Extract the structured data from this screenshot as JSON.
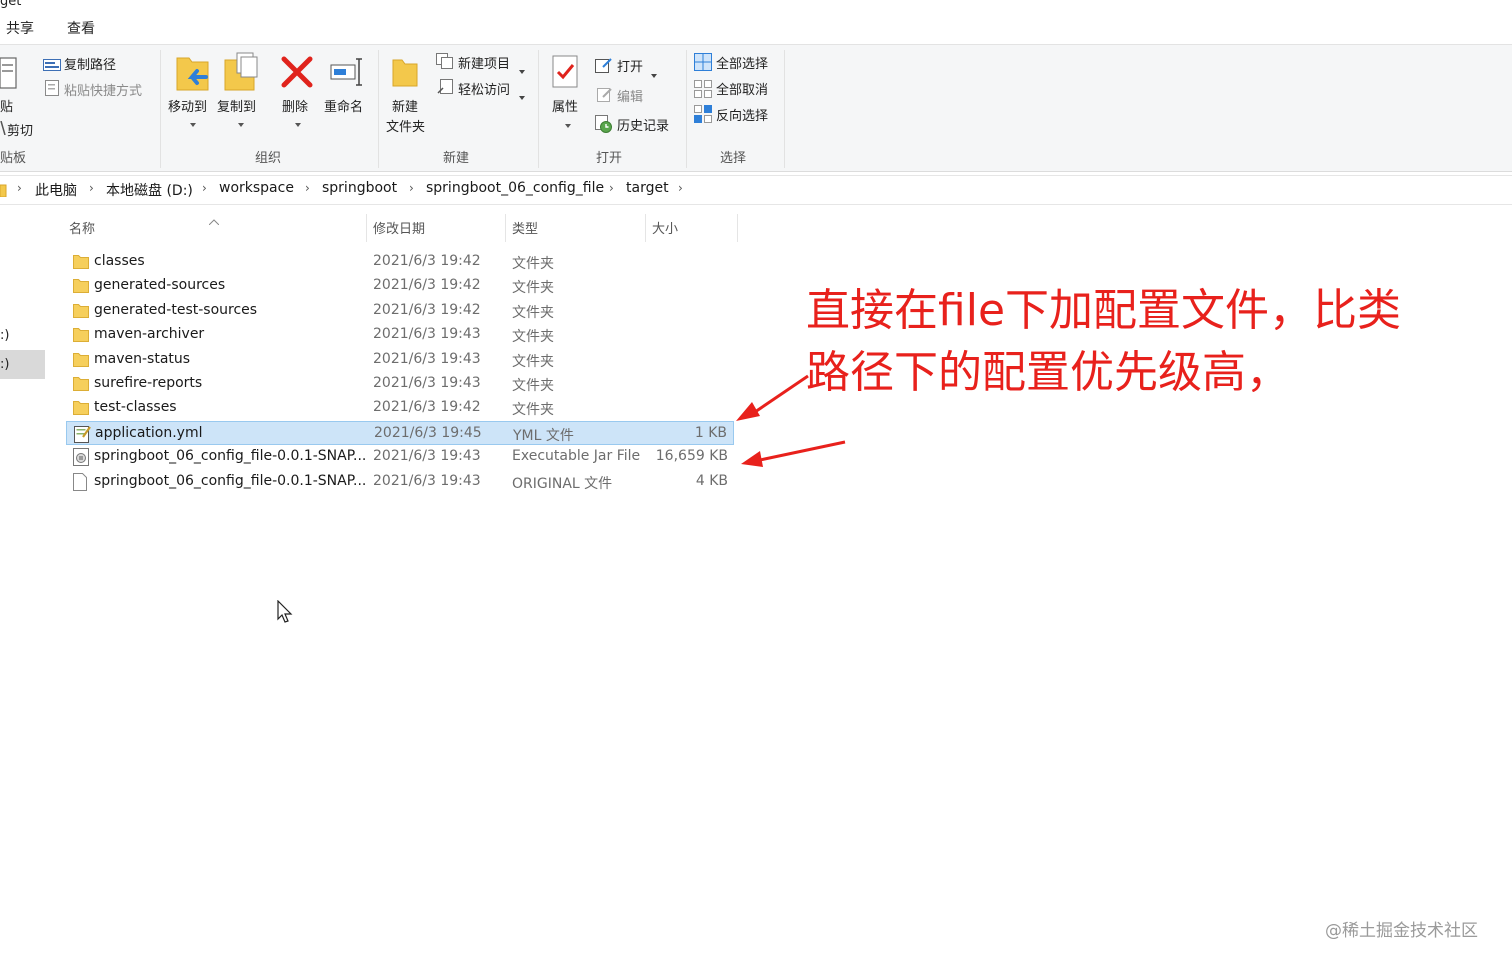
{
  "window": {
    "title_fragment": "get"
  },
  "menu_tabs": [
    {
      "label": "共享"
    },
    {
      "label": "查看"
    }
  ],
  "ribbon": {
    "clipboard": {
      "paste_fragment": "贴",
      "copy_path": "复制路径",
      "paste_shortcut": "粘贴快捷方式",
      "cut": "剪切",
      "group_fragment": "贴板"
    },
    "organize": {
      "move_to": "移动到",
      "copy_to": "复制到",
      "delete": "删除",
      "rename": "重命名",
      "group": "组织"
    },
    "new": {
      "new_folder_line1": "新建",
      "new_folder_line2": "文件夹",
      "new_item": "新建项目",
      "easy_access": "轻松访问",
      "group": "新建"
    },
    "open": {
      "properties": "属性",
      "open": "打开",
      "edit": "编辑",
      "history": "历史记录",
      "group": "打开"
    },
    "select": {
      "select_all": "全部选择",
      "select_none": "全部取消",
      "invert": "反向选择",
      "group": "选择"
    }
  },
  "address": {
    "breadcrumbs": [
      "此电脑",
      "本地磁盘 (D:)",
      "workspace",
      "springboot",
      "springboot_06_config_file",
      "target"
    ]
  },
  "nav": {
    "frag1": ":)",
    "frag2": ":)"
  },
  "columns": {
    "name": "名称",
    "modified": "修改日期",
    "type": "类型",
    "size": "大小"
  },
  "files": [
    {
      "name": "classes",
      "modified": "2021/6/3 19:42",
      "type": "文件夹",
      "size": "",
      "icon": "folder-icon"
    },
    {
      "name": "generated-sources",
      "modified": "2021/6/3 19:42",
      "type": "文件夹",
      "size": "",
      "icon": "folder-icon"
    },
    {
      "name": "generated-test-sources",
      "modified": "2021/6/3 19:42",
      "type": "文件夹",
      "size": "",
      "icon": "folder-icon"
    },
    {
      "name": "maven-archiver",
      "modified": "2021/6/3 19:43",
      "type": "文件夹",
      "size": "",
      "icon": "folder-icon"
    },
    {
      "name": "maven-status",
      "modified": "2021/6/3 19:43",
      "type": "文件夹",
      "size": "",
      "icon": "folder-icon"
    },
    {
      "name": "surefire-reports",
      "modified": "2021/6/3 19:43",
      "type": "文件夹",
      "size": "",
      "icon": "folder-icon"
    },
    {
      "name": "test-classes",
      "modified": "2021/6/3 19:42",
      "type": "文件夹",
      "size": "",
      "icon": "folder-icon"
    },
    {
      "name": "application.yml",
      "modified": "2021/6/3 19:45",
      "type": "YML 文件",
      "size": "1 KB",
      "icon": "yml-file-icon",
      "selected": true
    },
    {
      "name": "springboot_06_config_file-0.0.1-SNAP...",
      "modified": "2021/6/3 19:43",
      "type": "Executable Jar File",
      "size": "16,659 KB",
      "icon": "jar-file-icon"
    },
    {
      "name": "springboot_06_config_file-0.0.1-SNAP...",
      "modified": "2021/6/3 19:43",
      "type": "ORIGINAL 文件",
      "size": "4 KB",
      "icon": "blank-file-icon"
    }
  ],
  "annotation": {
    "line1": "直接在file下加配置文件，比类",
    "line2": "路径下的配置优先级高，",
    "color": "#e8211c"
  },
  "watermark": "@稀土掘金技术社区"
}
